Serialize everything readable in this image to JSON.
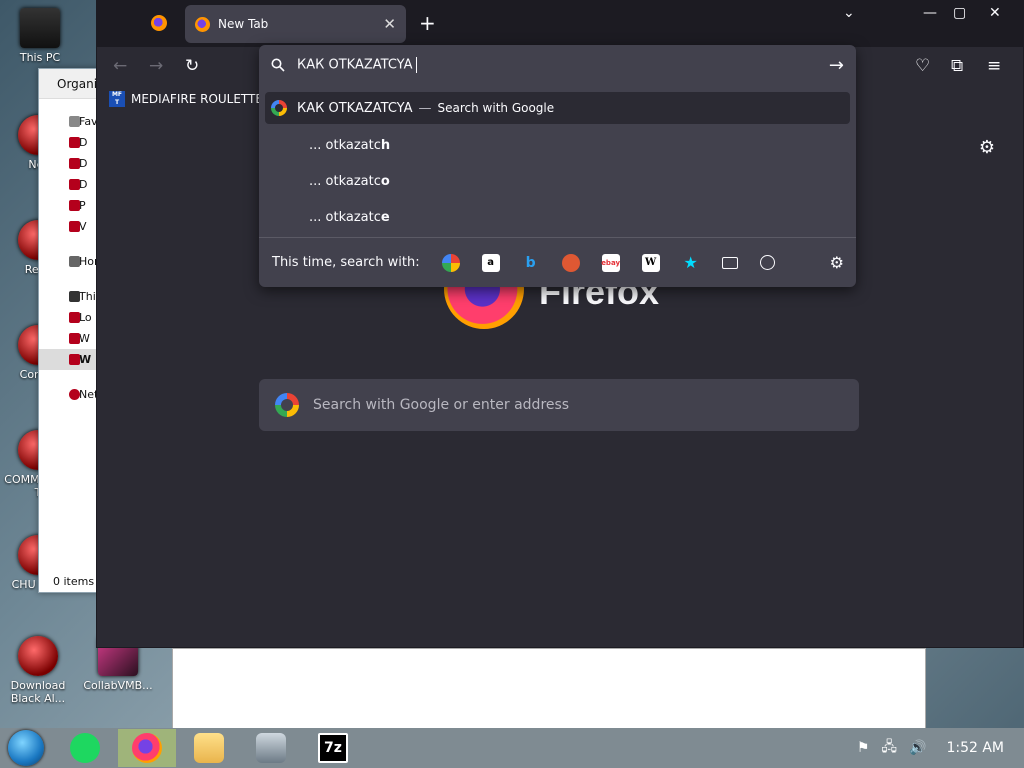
{
  "desktop": {
    "icons": [
      {
        "label": "This PC"
      },
      {
        "label": "Net"
      },
      {
        "label": "Recy"
      },
      {
        "label": "Contro"
      },
      {
        "label": "COMM HATE T"
      },
      {
        "label": "CHU CUM"
      },
      {
        "label": "Download Black Al..."
      },
      {
        "label": "CollabVMB..."
      }
    ]
  },
  "explorer": {
    "toolbar": "Organiz",
    "nav": [
      "Favo",
      "D",
      "D",
      "D",
      "P",
      "V",
      "Hon",
      "This",
      "Lo",
      "W",
      "W",
      "Net"
    ],
    "status": "0 items"
  },
  "firefox": {
    "tab": {
      "title": "New Tab",
      "close": "✕"
    },
    "new_tab": "+",
    "controls": {
      "minimize": "—",
      "maximize": "▢",
      "close": "✕",
      "list_all_tabs": "⌄"
    },
    "toolbar": {
      "back": "←",
      "forward": "→",
      "reload": "↻",
      "pocket": "♡",
      "extensions": "⧉",
      "menu": "≡"
    },
    "bookmarks": [
      {
        "label": "MEDIAFIRE ROULETTER",
        "favicon_text": "MF T"
      }
    ],
    "new_tab_page": {
      "logo_text": "Firefox",
      "search_placeholder": "Search with Google or enter address",
      "settings_icon": "⚙"
    },
    "urlbar": {
      "value": "КАК OTKAZATCYA",
      "go_icon": "→",
      "results": [
        {
          "text": "КАК OTKAZATCYA",
          "separator": "—",
          "action": "Search with Google"
        },
        {
          "prefix": "... otkazatc",
          "bold": "h"
        },
        {
          "prefix": "... otkazatc",
          "bold": "o"
        },
        {
          "prefix": "... otkazatc",
          "bold": "e"
        }
      ],
      "oneoff_label": "This time, search with:",
      "engines": [
        "google",
        "amazon",
        "bing",
        "duckduckgo",
        "ebay",
        "wikipedia",
        "bookmarks",
        "tabs",
        "history"
      ],
      "settings_icon": "⚙"
    }
  },
  "taskbar": {
    "clock": "1:52 AM",
    "apps": [
      "spotify",
      "firefox",
      "file-explorer",
      "computer",
      "7zip"
    ],
    "sevenzip_label": "7z"
  }
}
